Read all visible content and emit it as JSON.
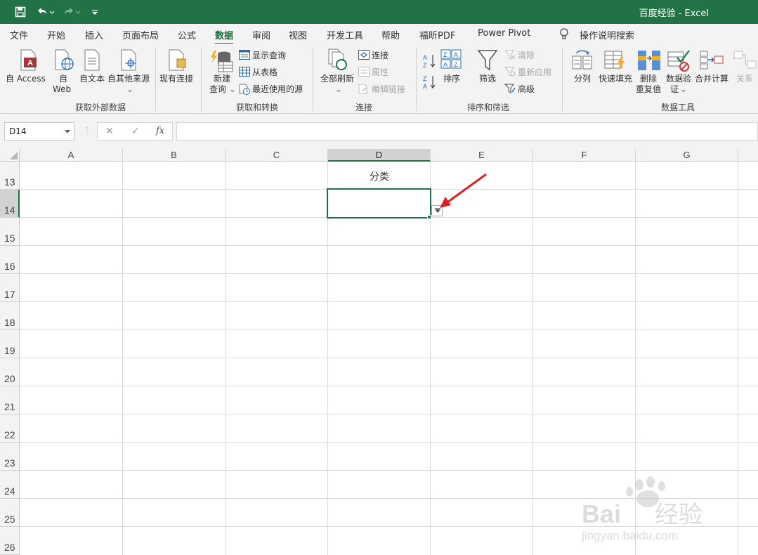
{
  "window": {
    "title": "百度经验  -  Excel"
  },
  "menu": {
    "tabs": [
      "文件",
      "开始",
      "插入",
      "页面布局",
      "公式",
      "数据",
      "审阅",
      "视图",
      "开发工具",
      "帮助",
      "福昕PDF",
      "Power Pivot"
    ],
    "active": "数据",
    "search_label": "操作说明搜索"
  },
  "ribbon": {
    "get_external": {
      "label": "获取外部数据",
      "access": "自 Access",
      "web_line1": "自",
      "web_line2": "Web",
      "text": "自文本",
      "other": "自其他来源",
      "existing": "现有连接"
    },
    "get_transform": {
      "label": "获取和转换",
      "new_query_line1": "新建",
      "new_query_line2": "查询",
      "show_query": "显示查询",
      "from_table": "从表格",
      "recent_sources": "最近使用的源"
    },
    "connections": {
      "label": "连接",
      "refresh_all": "全部刷新",
      "connections": "连接",
      "properties": "属性",
      "edit_links": "编辑链接"
    },
    "sort_filter": {
      "label": "排序和筛选",
      "sort": "排序",
      "filter": "筛选",
      "clear": "清除",
      "reapply": "重新应用",
      "advanced": "高级"
    },
    "data_tools": {
      "label": "数据工具",
      "text_to_columns": "分列",
      "flash_fill": "快速填充",
      "remove_dup_line1": "删除",
      "remove_dup_line2": "重复值",
      "validation_line1": "数据验",
      "validation_line2": "证",
      "consolidate": "合并计算",
      "relations": "关系"
    }
  },
  "formula_bar": {
    "name_box": "D14",
    "cancel": "✕",
    "enter": "✓",
    "fx": "fx",
    "content": ""
  },
  "sheet": {
    "columns": [
      "A",
      "B",
      "C",
      "D",
      "E",
      "F",
      "G"
    ],
    "selected_column": "D",
    "rows": [
      "13",
      "14",
      "15",
      "16",
      "17",
      "18",
      "19",
      "20",
      "21",
      "22",
      "23",
      "24",
      "25",
      "26"
    ],
    "selected_row": "14",
    "cells": {
      "D13": "分类"
    }
  },
  "watermark": {
    "brand": "Bai",
    "brand2": "经验",
    "url": "jingyan.baidu.com"
  },
  "colors": {
    "accent": "#217346",
    "arrow": "#e02020"
  }
}
